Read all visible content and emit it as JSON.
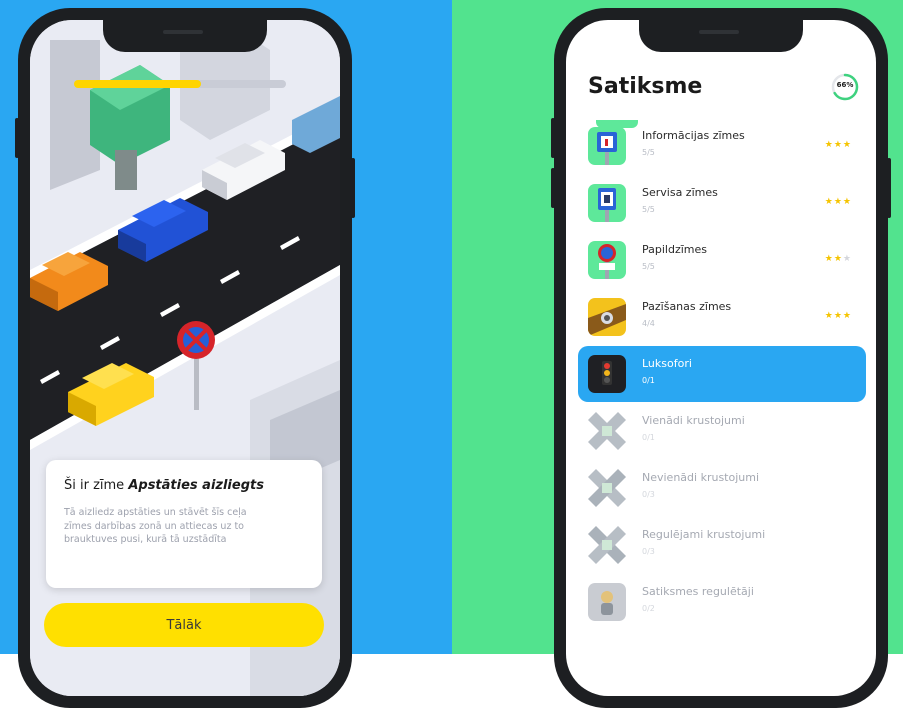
{
  "progress": {
    "fraction": 0.6
  },
  "sign_card": {
    "title_prefix": "Ši ir zīme ",
    "title_sign": "Apstāties aizliegts",
    "body": "Tā aizliedz apstāties un stāvēt šīs ceļa zīmes darbības zonā un attiecas uz to brauktuves pusi, kurā tā uzstādīta",
    "next_label": "Tālāk"
  },
  "app": {
    "title": "Satiksme",
    "percent_label": "66%",
    "percent_value": 0.66
  },
  "categories": [
    {
      "title": "Informācijas zīmes",
      "sub": "5/5",
      "stars": 3,
      "state": "done"
    },
    {
      "title": "Servisa zīmes",
      "sub": "5/5",
      "stars": 3,
      "state": "done"
    },
    {
      "title": "Papildzīmes",
      "sub": "5/5",
      "stars": 2,
      "state": "done"
    },
    {
      "title": "Pazīšanas zīmes",
      "sub": "4/4",
      "stars": 3,
      "state": "done"
    },
    {
      "title": "Luksofori",
      "sub": "0/1",
      "stars": 0,
      "state": "active"
    },
    {
      "title": "Vienādi krustojumi",
      "sub": "0/1",
      "stars": 0,
      "state": "locked"
    },
    {
      "title": "Nevienādi krustojumi",
      "sub": "0/3",
      "stars": 0,
      "state": "locked"
    },
    {
      "title": "Regulējami krustojumi",
      "sub": "0/3",
      "stars": 0,
      "state": "locked"
    },
    {
      "title": "Satiksmes regulētāji",
      "sub": "0/2",
      "stars": 0,
      "state": "locked"
    }
  ],
  "colors": {
    "left_background": "#2aa7f2",
    "right_background": "#52e38e",
    "accent_yellow": "#ffe000",
    "active_row": "#2aa7f2",
    "star": "#f5c400"
  }
}
